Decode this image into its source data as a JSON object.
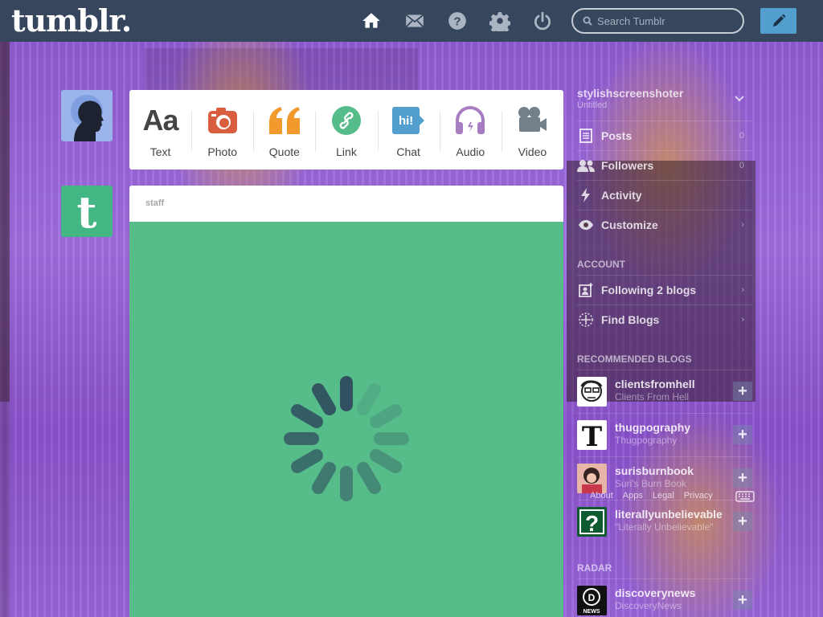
{
  "header": {
    "logo": "tumblr.",
    "search_placeholder": "Search Tumblr"
  },
  "post_types": [
    {
      "label": "Text",
      "glyph": "Aa",
      "icon": "text-icon",
      "color": "#444444"
    },
    {
      "label": "Photo",
      "icon": "photo-icon",
      "color": "#d95e40"
    },
    {
      "label": "Quote",
      "icon": "quote-icon",
      "color": "#f2992e"
    },
    {
      "label": "Link",
      "icon": "link-icon",
      "color": "#56bc8a"
    },
    {
      "label": "Chat",
      "glyph": "hi!",
      "icon": "chat-icon",
      "color": "#529ecc"
    },
    {
      "label": "Audio",
      "icon": "audio-icon",
      "color": "#a77dc2"
    },
    {
      "label": "Video",
      "icon": "video-icon",
      "color": "#748089"
    }
  ],
  "post": {
    "author": "staff",
    "color": "#56bc8a"
  },
  "sidebar": {
    "blog_name": "stylishscreenshoter",
    "blog_sub": "Untitled",
    "rows": [
      {
        "label": "Posts",
        "count": "0"
      },
      {
        "label": "Followers",
        "count": "0"
      },
      {
        "label": "Activity",
        "count": ""
      },
      {
        "label": "Customize",
        "count": ""
      }
    ],
    "account_heading": "ACCOUNT",
    "account_rows": [
      {
        "label": "Following 2 blogs"
      },
      {
        "label": "Find Blogs"
      }
    ],
    "recommended_heading": "RECOMMENDED BLOGS",
    "recommended": [
      {
        "name": "clientsfromhell",
        "title": "Clients From Hell"
      },
      {
        "name": "thugpography",
        "title": "Thugpography"
      },
      {
        "name": "surisburnbook",
        "title": "Suri's Burn Book"
      },
      {
        "name": "literallyunbelievable",
        "title": "\"Literally Unbelievable\""
      }
    ],
    "radar_heading": "RADAR",
    "radar": [
      {
        "name": "discoverynews",
        "title": "DiscoveryNews"
      }
    ]
  },
  "footer_links": [
    "About",
    "Apps",
    "Legal",
    "Privacy"
  ]
}
